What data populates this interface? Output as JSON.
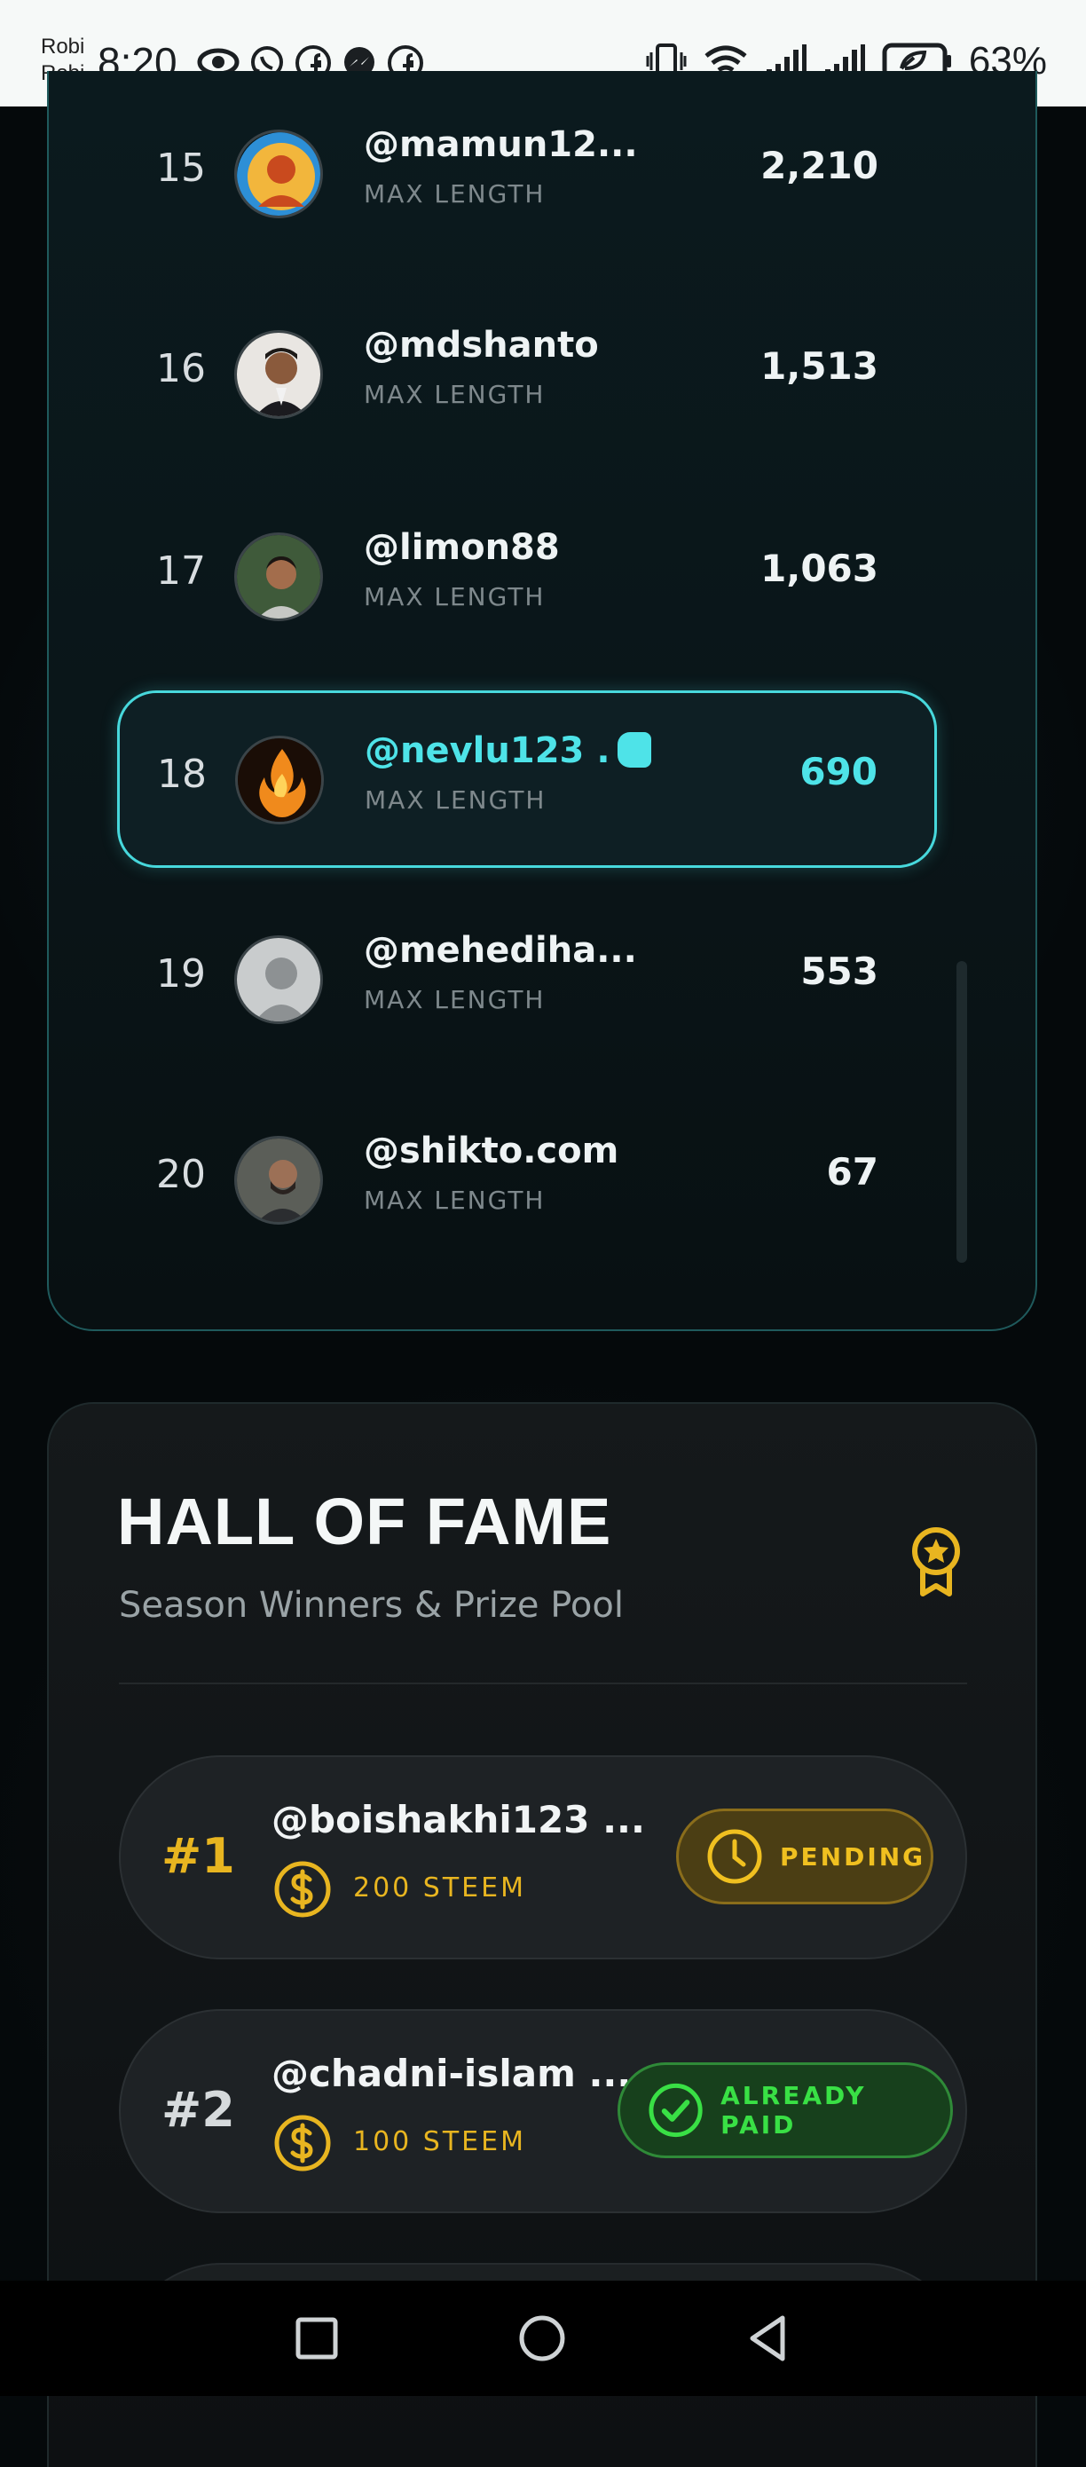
{
  "status_bar": {
    "carrier_line1": "Robi",
    "carrier_line2": "Robi",
    "time": "8:20",
    "battery": "63%",
    "left_icons": [
      "eye-icon",
      "whatsapp-icon",
      "facebook-icon",
      "messenger-icon",
      "facebook-icon"
    ],
    "right_icons": [
      "vibrate-icon",
      "wifi-icon",
      "signal-icon",
      "signal-icon",
      "battery-saver-icon"
    ]
  },
  "leaderboard": {
    "rows": [
      {
        "rank": "15",
        "user": "@mamun12...",
        "label": "MAX LENGTH",
        "score": "2,210"
      },
      {
        "rank": "16",
        "user": "@mdshanto",
        "label": "MAX LENGTH",
        "score": "1,513"
      },
      {
        "rank": "17",
        "user": "@limon88",
        "label": "MAX LENGTH",
        "score": "1,063"
      },
      {
        "rank": "18",
        "user": "@nevlu123",
        "user_suffix": ".",
        "label": "MAX LENGTH",
        "score": "690"
      },
      {
        "rank": "19",
        "user": "@mehediha...",
        "label": "MAX LENGTH",
        "score": "553"
      },
      {
        "rank": "20",
        "user": "@shikto.com",
        "label": "MAX LENGTH",
        "score": "67"
      }
    ]
  },
  "hall_of_fame": {
    "title": "HALL OF FAME",
    "subtitle": "Season Winners & Prize Pool",
    "badge_icon": "award-ribbon-icon",
    "winners": [
      {
        "place": "#1",
        "user": "@boishakhi123 ...",
        "amount": "200 STEEM",
        "status": "PENDING",
        "status_icon": "clock-icon"
      },
      {
        "place": "#2",
        "user": "@chadni-islam ...",
        "amount": "100 STEEM",
        "status": "ALREADY PAID",
        "status_icon": "check-circle-icon"
      }
    ]
  },
  "colors": {
    "accent": "#47d8dc",
    "gold": "#e8b520",
    "pending": "#f0c020",
    "paid": "#39e045"
  },
  "nav_bar": {
    "buttons": [
      "recents-icon",
      "home-icon",
      "back-icon"
    ]
  }
}
